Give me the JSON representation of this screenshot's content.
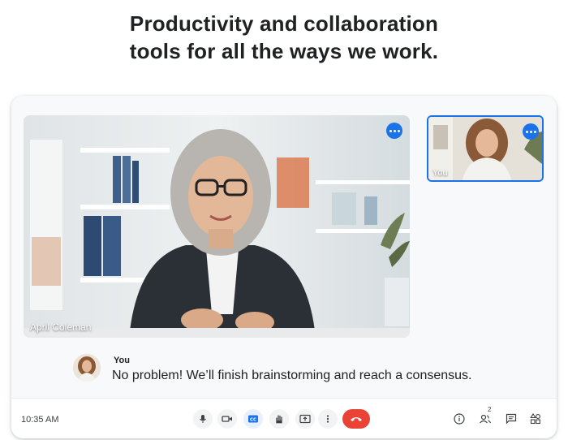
{
  "headline": {
    "line1": "Productivity and collaboration",
    "line2": "tools for all the ways we work."
  },
  "main_tile": {
    "participant_name": "April Coleman",
    "menu_icon": "more-horiz-icon"
  },
  "self_tile": {
    "label": "You",
    "menu_icon": "more-horiz-icon"
  },
  "caption": {
    "speaker": "You",
    "text": "No problem! We’ll finish brainstorming and reach a consensus."
  },
  "toolbar": {
    "time": "10:35 AM",
    "controls": [
      "mic-icon",
      "camera-icon",
      "closed-captions-icon",
      "raise-hand-icon",
      "present-screen-icon",
      "more-vert-icon",
      "end-call-icon"
    ],
    "right_icons": [
      "info-icon",
      "people-icon",
      "chat-icon",
      "activities-icon"
    ],
    "people_count": "2"
  },
  "colors": {
    "accent": "#1a73e8",
    "end_call": "#ea4335",
    "card_bg": "#f8f9fa"
  }
}
